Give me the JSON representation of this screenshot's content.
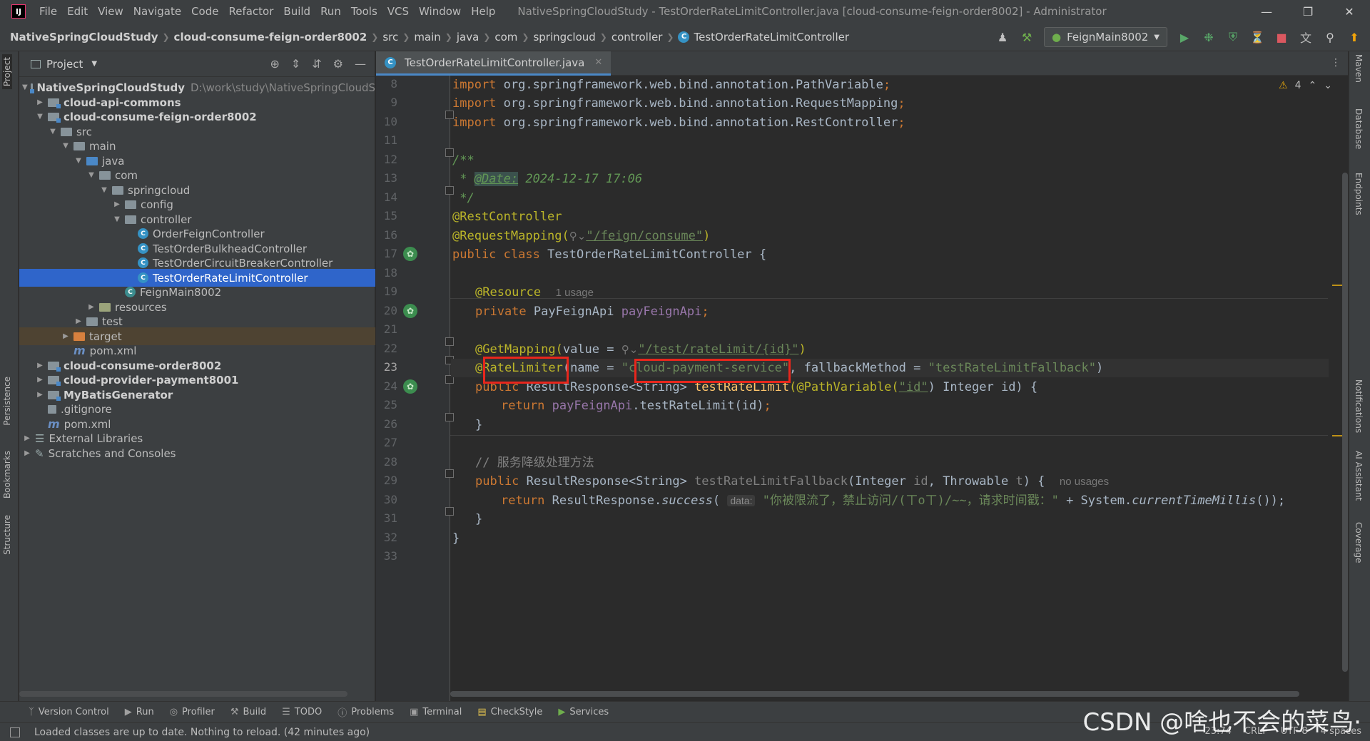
{
  "titlebar": {
    "menu": [
      "File",
      "Edit",
      "View",
      "Navigate",
      "Code",
      "Refactor",
      "Build",
      "Run",
      "Tools",
      "VCS",
      "Window",
      "Help"
    ],
    "title": "NativeSpringCloudStudy - TestOrderRateLimitController.java [cloud-consume-feign-order8002] - Administrator",
    "logo": "IJ"
  },
  "breadcrumb": [
    "NativeSpringCloudStudy",
    "cloud-consume-feign-order8002",
    "src",
    "main",
    "java",
    "com",
    "springcloud",
    "controller",
    "TestOrderRateLimitController"
  ],
  "run_config": "FeignMain8002",
  "project_panel": {
    "title": "Project",
    "items": [
      {
        "label": "NativeSpringCloudStudy",
        "path": "D:\\work\\study\\NativeSpringCloudS"
      },
      {
        "label": "cloud-api-commons"
      },
      {
        "label": "cloud-consume-feign-order8002"
      },
      {
        "label": "src"
      },
      {
        "label": "main"
      },
      {
        "label": "java"
      },
      {
        "label": "com"
      },
      {
        "label": "springcloud"
      },
      {
        "label": "config"
      },
      {
        "label": "controller"
      },
      {
        "label": "OrderFeignController"
      },
      {
        "label": "TestOrderBulkheadController"
      },
      {
        "label": "TestOrderCircuitBreakerController"
      },
      {
        "label": "TestOrderRateLimitController"
      },
      {
        "label": "FeignMain8002"
      },
      {
        "label": "resources"
      },
      {
        "label": "test"
      },
      {
        "label": "target"
      },
      {
        "label": "pom.xml"
      },
      {
        "label": "cloud-consume-order8002"
      },
      {
        "label": "cloud-provider-payment8001"
      },
      {
        "label": "MyBatisGenerator"
      },
      {
        "label": ".gitignore"
      },
      {
        "label": "pom.xml"
      },
      {
        "label": "External Libraries"
      },
      {
        "label": "Scratches and Consoles"
      }
    ]
  },
  "editor": {
    "tab": "TestOrderRateLimitController.java",
    "warnings": "4",
    "line_numbers": [
      "8",
      "9",
      "10",
      "11",
      "12",
      "13",
      "14",
      "15",
      "16",
      "17",
      "18",
      "19",
      "20",
      "21",
      "22",
      "23",
      "24",
      "25",
      "26",
      "27",
      "28",
      "29",
      "30",
      "31",
      "32",
      "33"
    ],
    "current_line": "23",
    "code": {
      "import": "import",
      "imp8": " org.springframework.web.bind.annotation.PathVariable",
      "imp9": " org.springframework.web.bind.annotation.RequestMapping",
      "imp10": " org.springframework.web.bind.annotation.RestController",
      "semi": ";",
      "doc_open": "/**",
      "doc_star": " * ",
      "doc_tag": "@Date:",
      "doc_date": " 2024-12-17 17:06",
      "doc_close": " */",
      "rest_controller": "@RestController",
      "request_mapping": "@RequestMapping(",
      "feign_path": "\"/feign/consume\"",
      "close_paren": ")",
      "public": "public",
      "class": " class",
      "class_name": " TestOrderRateLimitController {",
      "resource": "@Resource",
      "usage_hint": "1 usage",
      "private": "private",
      "feign_type": " PayFeignApi ",
      "feign_field": "payFeignApi",
      "get_mapping": "@GetMapping(",
      "value_eq": "value = ",
      "test_path": "\"/test/rateLimit/{id}\"",
      "rate_limiter": "@RateLimiter",
      "name_eq": "(name = ",
      "service_name": "\"cloud-payment-service\"",
      "fallback_eq": ", fallbackMethod = ",
      "fallback_name": "\"testRateLimitFallback\"",
      "result_type": " ResultResponse<String> ",
      "method1": "testRateLimit",
      "path_variable": "(@PathVariable(",
      "id_str": "\"id\"",
      "param1": ") Integer id) {",
      "return": "return",
      "call_pre": " ",
      "call": ".testRateLimit(id)",
      "close_brace": "}",
      "comment": "// 服务降级处理方法",
      "method2": "testRateLimitFallback",
      "param2_a": "(Integer ",
      "param2_id": "id",
      "param2_b": ", Throwable ",
      "param2_t": "t",
      "param2_c": ") {",
      "no_usages": "no usages",
      "success_pre": " ResultResponse.",
      "success": "success",
      "data_hint": "data:",
      "msg_str": "\"你被限流了，禁止访问/(ㄒoㄒ)/~~，请求时间戳：\"",
      "plus_sys": " + System.",
      "millis": "currentTimeMillis",
      "end_call": "());"
    }
  },
  "bottom_tools": [
    "Version Control",
    "Run",
    "Profiler",
    "Build",
    "TODO",
    "Problems",
    "Terminal",
    "CheckStyle",
    "Services"
  ],
  "status": {
    "message": "Loaded classes are up to date. Nothing to reload. (42 minutes ago)",
    "position": "23:74",
    "line_sep": "CRLF",
    "encoding": "UTF-8",
    "indent": "4 spaces"
  },
  "left_tabs": [
    "Project",
    "Persistence",
    "Bookmarks",
    "Structure"
  ],
  "right_tabs": [
    "Maven",
    "Database",
    "Endpoints",
    "Notifications",
    "AI Assistant",
    "Coverage"
  ],
  "watermark": "CSDN @啥也不会的菜鸟·"
}
